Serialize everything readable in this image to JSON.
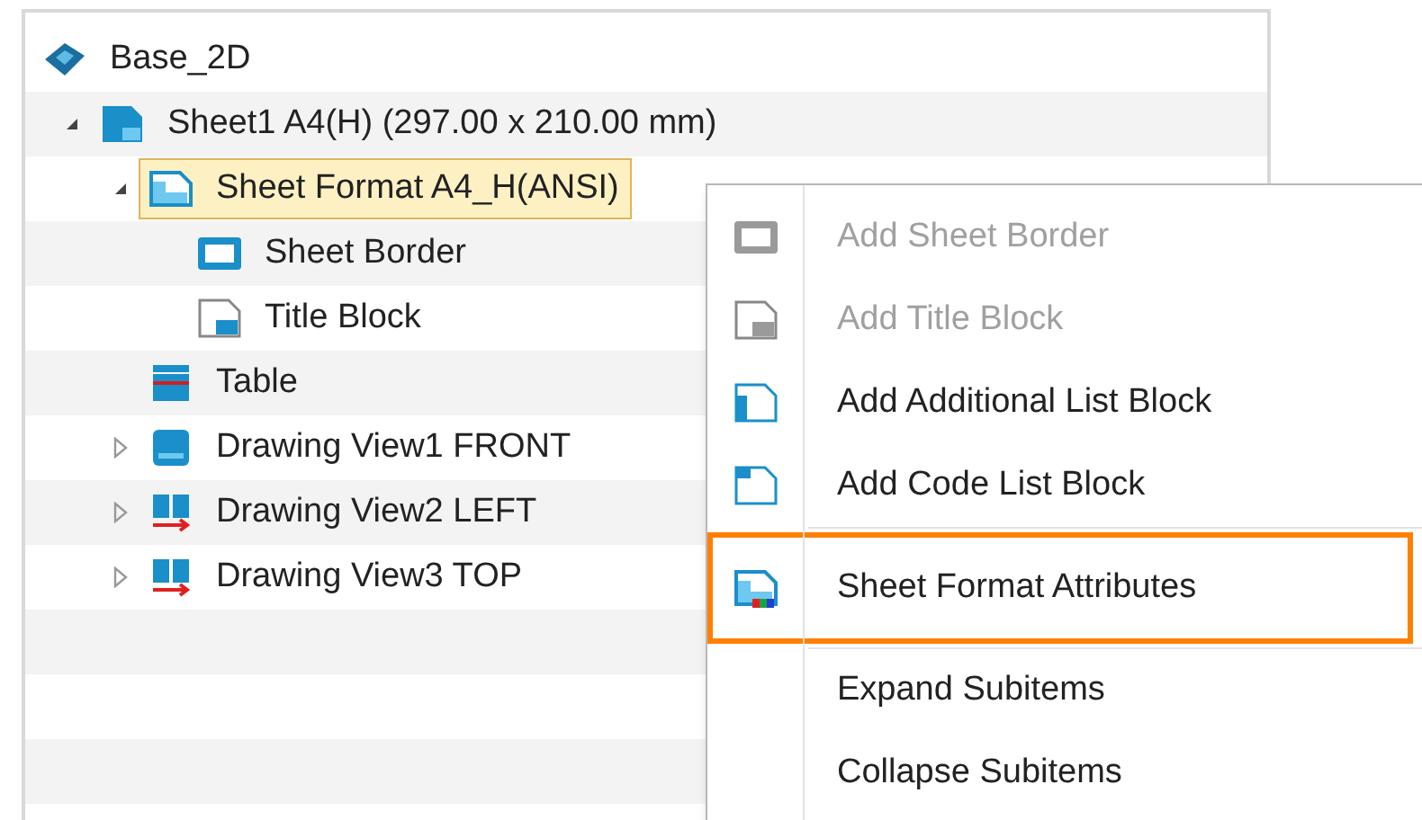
{
  "tree": [
    {
      "label": "Base_2D",
      "kind": "model",
      "selected": false,
      "children": [
        {
          "label": "Sheet1 A4(H) (297.00 x 210.00 mm)",
          "kind": "sheet",
          "selected": false,
          "expanded": true,
          "children": [
            {
              "label": "Sheet Format A4_H(ANSI)",
              "kind": "sheet-format",
              "selected": true,
              "expanded": true,
              "children": [
                {
                  "label": "Sheet Border",
                  "kind": "border",
                  "selected": false
                },
                {
                  "label": "Title Block",
                  "kind": "title-block",
                  "selected": false
                }
              ]
            },
            {
              "label": "Table",
              "kind": "table",
              "selected": false
            },
            {
              "label": "Drawing View1 FRONT",
              "kind": "front-view",
              "selected": false,
              "expanded": false
            },
            {
              "label": "Drawing View2 LEFT",
              "kind": "side-view",
              "selected": false,
              "expanded": false
            },
            {
              "label": "Drawing View3 TOP",
              "kind": "side-view",
              "selected": false,
              "expanded": false
            }
          ]
        }
      ]
    }
  ],
  "context_menu": {
    "groups": [
      [
        {
          "label": "Add Sheet Border",
          "kind": "border",
          "disabled": true,
          "highlighted": false
        },
        {
          "label": "Add Title Block",
          "kind": "title-block",
          "disabled": true,
          "highlighted": false
        },
        {
          "label": "Add Additional List Block",
          "kind": "list-block",
          "disabled": false,
          "highlighted": false
        },
        {
          "label": "Add Code List Block",
          "kind": "code-block",
          "disabled": false,
          "highlighted": false
        }
      ],
      [
        {
          "label": "Sheet Format Attributes",
          "kind": "attributes",
          "disabled": false,
          "highlighted": true
        }
      ],
      [
        {
          "label": "Expand Subitems",
          "kind": "plain",
          "disabled": false,
          "highlighted": false
        },
        {
          "label": "Collapse Subitems",
          "kind": "plain",
          "disabled": false,
          "highlighted": false
        }
      ]
    ]
  }
}
